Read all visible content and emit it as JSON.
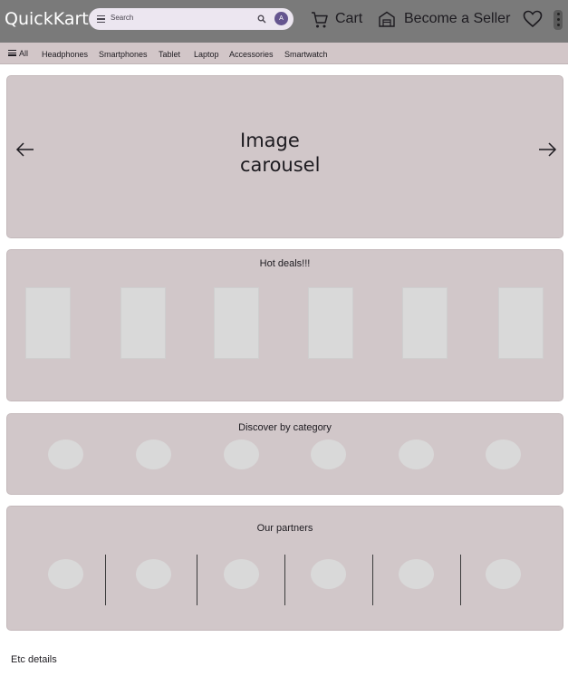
{
  "header": {
    "logo": "QuickKart",
    "search_placeholder": "Search",
    "avatar_initial": "A",
    "cart_label": "Cart",
    "seller_label": "Become a Seller"
  },
  "categories": {
    "all_label": "All",
    "items": [
      "Headphones",
      "Smartphones",
      "Tablet",
      "Laptop",
      "Accessories",
      "Smartwatch"
    ]
  },
  "carousel": {
    "label": "Image\ncarousel"
  },
  "deals": {
    "title": "Hot deals!!!"
  },
  "discover": {
    "title": "Discover by category"
  },
  "partners": {
    "title": "Our partners"
  },
  "footer": {
    "etc_label": "Etc details"
  },
  "colors": {
    "topbar": "#7a7a7a",
    "panel": "#d1c7c9",
    "placeholder": "#d9d9d9",
    "avatar": "#65558f"
  }
}
